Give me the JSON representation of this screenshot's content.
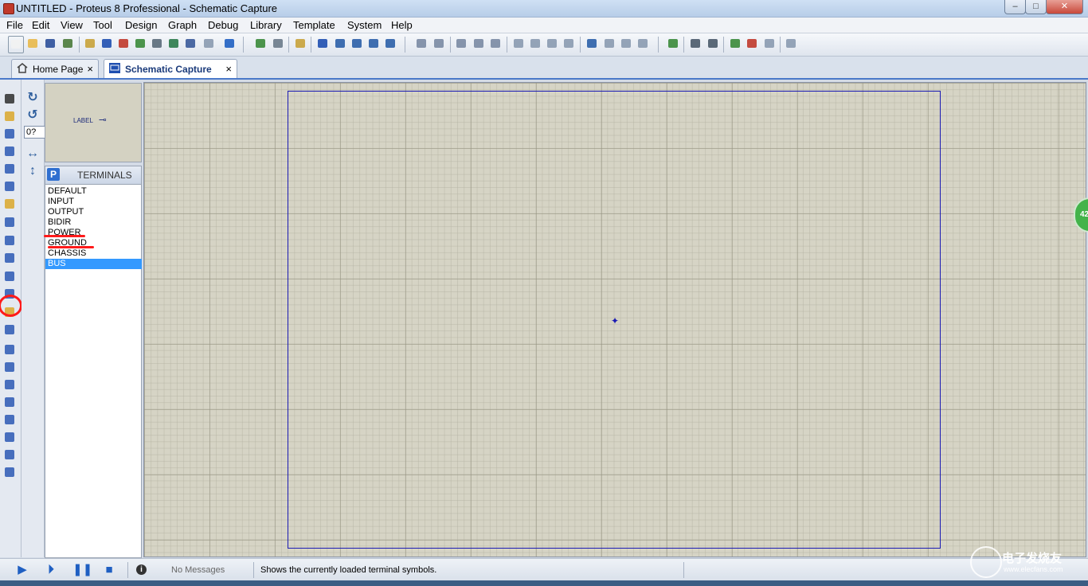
{
  "window": {
    "title": "UNTITLED - Proteus 8 Professional - Schematic Capture"
  },
  "menu": [
    "File",
    "Edit",
    "View",
    "Tool",
    "Design",
    "Graph",
    "Debug",
    "Library",
    "Template",
    "System",
    "Help"
  ],
  "tabs": [
    {
      "label": "Home Page",
      "close": "×"
    },
    {
      "label": "Schematic Capture",
      "close": "×"
    }
  ],
  "rotation": {
    "angle": "0?"
  },
  "preview": {
    "label": "LABEL"
  },
  "terminals": {
    "button": "P",
    "title": "TERMINALS",
    "items": [
      "DEFAULT",
      "INPUT",
      "OUTPUT",
      "BIDIR",
      "POWER",
      "GROUND",
      "CHASSIS",
      "BUS"
    ],
    "selected": "BUS"
  },
  "status": {
    "messages": "No Messages",
    "text": "Shows the currently loaded terminal symbols."
  },
  "side_badge": "42",
  "watermark": {
    "text": "电子发烧友",
    "url": "www.elecfans.com"
  },
  "colors": {
    "accent": "#3399ff",
    "sheet_border": "#1a1ab3",
    "annotation": "#ff1a1a",
    "canvas": "#d6d4c5"
  }
}
